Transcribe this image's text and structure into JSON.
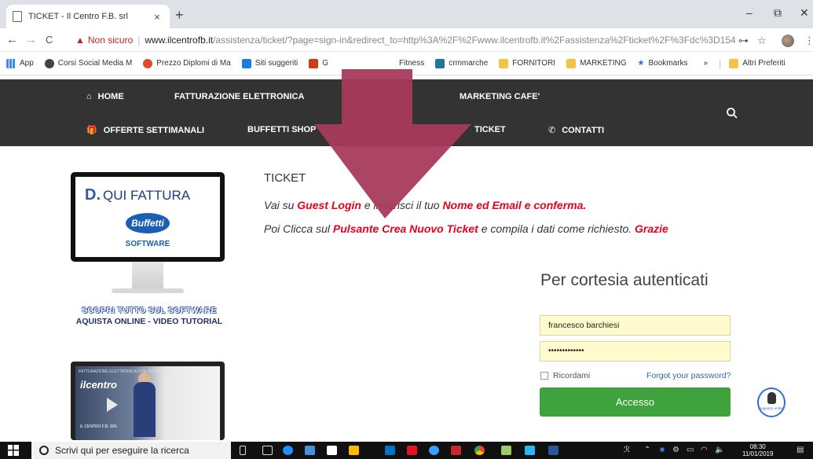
{
  "browser": {
    "tab_title": "TICKET - Il Centro F.B. srl",
    "tab_close": "×",
    "new_tab": "+",
    "controls": {
      "minimize": "–",
      "restore": "⧉",
      "close": "✕"
    },
    "nav": {
      "back": "←",
      "forward": "→",
      "reload": "C"
    },
    "address": {
      "warning": "Non sicuro",
      "host": "www.ilcentrofb.it",
      "path": "/assistenza/ticket/?page=sign-in&redirect_to=http%3A%2F%2Fwww.ilcentrofb.it%2Fassistenza%2Fticket%2F%3Fdc%3D1547191..."
    },
    "bookmarks": [
      {
        "label": "App",
        "color": "#4285f4"
      },
      {
        "label": "Corsi Social Media M",
        "color": "#444444"
      },
      {
        "label": "Prezzo Diplomi di Ma",
        "color": "#e24a2b"
      },
      {
        "label": "Siti suggeriti",
        "color": "#1c7ed6"
      },
      {
        "label": "G",
        "color": "#d23b14"
      },
      {
        "label": "Fitness",
        "color": "#ffffff"
      },
      {
        "label": "crmmarche",
        "color": "#21759b"
      },
      {
        "label": "FORNITORI",
        "color": "#f5c342"
      },
      {
        "label": "MARKETING",
        "color": "#f5c342"
      },
      {
        "label": "Bookmarks",
        "color": "#1a73e8"
      },
      {
        "label": "»",
        "color": "#ffffff"
      },
      {
        "label": "Altri Preferiti",
        "color": "#f5c342"
      }
    ]
  },
  "site_nav": {
    "home": "HOME",
    "fatturazione": "FATTURAZIONE ELETTRONICA",
    "marketing_cafe": "MARKETING CAFE'",
    "offerte": "OFFERTE SETTIMANALI",
    "buffetti_shop": "BUFFETTI SHOP",
    "ticket": "TICKET",
    "contatti": "CONTATTI"
  },
  "promo": {
    "brand_title": "QUI FATTURA",
    "buffetti_logo": "Buffetti",
    "software": "SOFTWARE",
    "scopri_line1": "SCOPRI TUTTO SUL SOFTWARE",
    "scopri_line2": "AQUISTA ONLINE - VIDEO TUTORIAL",
    "video_title": "FATTURAZIONE ELETTRONICA CON ZERO EURO",
    "video_logo": "ilcentro",
    "video_caption": "IL CENTRO F.B. SRL"
  },
  "content": {
    "heading": "TICKET",
    "line1": {
      "a": "Vai su ",
      "b": "Guest Login",
      "c": " e inserisci il tuo ",
      "d": "Nome ed Email e conferma."
    },
    "line2": {
      "a": "Poi Clicca sul ",
      "b": "Pulsante Crea Nuovo Ticket",
      "c": " e compila i dati come richiesto. ",
      "d": "Grazie"
    }
  },
  "login": {
    "title": "Per cortesia autenticati",
    "username_value": "francesco barchiesi",
    "password_value": "•••••••••••••",
    "remember_label": "Ricordami",
    "forgot_label": "Forgot your password?",
    "submit_label": "Accesso"
  },
  "support_widget": {
    "label": "Supporto online"
  },
  "taskbar": {
    "search_placeholder": "Scrivi qui per eseguire la ricerca",
    "time": "08:30",
    "date": "11/01/2019"
  },
  "colors": {
    "nav_bg": "#333333",
    "accent_red": "#e8001c",
    "login_button": "#3fa33d",
    "arrow": "#a83a5c",
    "autofill": "#fffbcc"
  }
}
